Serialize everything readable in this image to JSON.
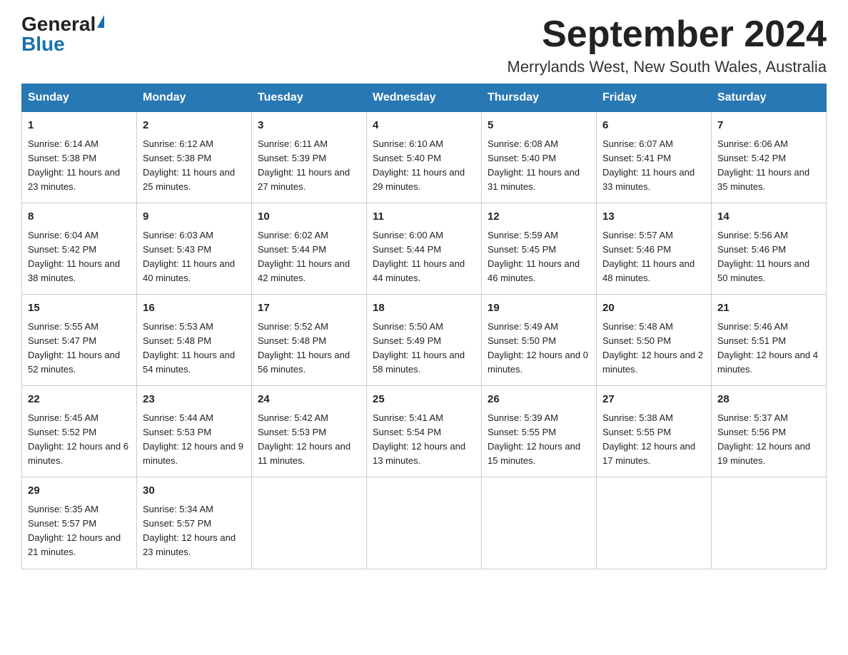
{
  "header": {
    "logo_text_black": "General",
    "logo_text_blue": "Blue",
    "month_title": "September 2024",
    "location": "Merrylands West, New South Wales, Australia"
  },
  "weekdays": [
    "Sunday",
    "Monday",
    "Tuesday",
    "Wednesday",
    "Thursday",
    "Friday",
    "Saturday"
  ],
  "weeks": [
    [
      {
        "day": "1",
        "sunrise": "6:14 AM",
        "sunset": "5:38 PM",
        "daylight": "11 hours and 23 minutes."
      },
      {
        "day": "2",
        "sunrise": "6:12 AM",
        "sunset": "5:38 PM",
        "daylight": "11 hours and 25 minutes."
      },
      {
        "day": "3",
        "sunrise": "6:11 AM",
        "sunset": "5:39 PM",
        "daylight": "11 hours and 27 minutes."
      },
      {
        "day": "4",
        "sunrise": "6:10 AM",
        "sunset": "5:40 PM",
        "daylight": "11 hours and 29 minutes."
      },
      {
        "day": "5",
        "sunrise": "6:08 AM",
        "sunset": "5:40 PM",
        "daylight": "11 hours and 31 minutes."
      },
      {
        "day": "6",
        "sunrise": "6:07 AM",
        "sunset": "5:41 PM",
        "daylight": "11 hours and 33 minutes."
      },
      {
        "day": "7",
        "sunrise": "6:06 AM",
        "sunset": "5:42 PM",
        "daylight": "11 hours and 35 minutes."
      }
    ],
    [
      {
        "day": "8",
        "sunrise": "6:04 AM",
        "sunset": "5:42 PM",
        "daylight": "11 hours and 38 minutes."
      },
      {
        "day": "9",
        "sunrise": "6:03 AM",
        "sunset": "5:43 PM",
        "daylight": "11 hours and 40 minutes."
      },
      {
        "day": "10",
        "sunrise": "6:02 AM",
        "sunset": "5:44 PM",
        "daylight": "11 hours and 42 minutes."
      },
      {
        "day": "11",
        "sunrise": "6:00 AM",
        "sunset": "5:44 PM",
        "daylight": "11 hours and 44 minutes."
      },
      {
        "day": "12",
        "sunrise": "5:59 AM",
        "sunset": "5:45 PM",
        "daylight": "11 hours and 46 minutes."
      },
      {
        "day": "13",
        "sunrise": "5:57 AM",
        "sunset": "5:46 PM",
        "daylight": "11 hours and 48 minutes."
      },
      {
        "day": "14",
        "sunrise": "5:56 AM",
        "sunset": "5:46 PM",
        "daylight": "11 hours and 50 minutes."
      }
    ],
    [
      {
        "day": "15",
        "sunrise": "5:55 AM",
        "sunset": "5:47 PM",
        "daylight": "11 hours and 52 minutes."
      },
      {
        "day": "16",
        "sunrise": "5:53 AM",
        "sunset": "5:48 PM",
        "daylight": "11 hours and 54 minutes."
      },
      {
        "day": "17",
        "sunrise": "5:52 AM",
        "sunset": "5:48 PM",
        "daylight": "11 hours and 56 minutes."
      },
      {
        "day": "18",
        "sunrise": "5:50 AM",
        "sunset": "5:49 PM",
        "daylight": "11 hours and 58 minutes."
      },
      {
        "day": "19",
        "sunrise": "5:49 AM",
        "sunset": "5:50 PM",
        "daylight": "12 hours and 0 minutes."
      },
      {
        "day": "20",
        "sunrise": "5:48 AM",
        "sunset": "5:50 PM",
        "daylight": "12 hours and 2 minutes."
      },
      {
        "day": "21",
        "sunrise": "5:46 AM",
        "sunset": "5:51 PM",
        "daylight": "12 hours and 4 minutes."
      }
    ],
    [
      {
        "day": "22",
        "sunrise": "5:45 AM",
        "sunset": "5:52 PM",
        "daylight": "12 hours and 6 minutes."
      },
      {
        "day": "23",
        "sunrise": "5:44 AM",
        "sunset": "5:53 PM",
        "daylight": "12 hours and 9 minutes."
      },
      {
        "day": "24",
        "sunrise": "5:42 AM",
        "sunset": "5:53 PM",
        "daylight": "12 hours and 11 minutes."
      },
      {
        "day": "25",
        "sunrise": "5:41 AM",
        "sunset": "5:54 PM",
        "daylight": "12 hours and 13 minutes."
      },
      {
        "day": "26",
        "sunrise": "5:39 AM",
        "sunset": "5:55 PM",
        "daylight": "12 hours and 15 minutes."
      },
      {
        "day": "27",
        "sunrise": "5:38 AM",
        "sunset": "5:55 PM",
        "daylight": "12 hours and 17 minutes."
      },
      {
        "day": "28",
        "sunrise": "5:37 AM",
        "sunset": "5:56 PM",
        "daylight": "12 hours and 19 minutes."
      }
    ],
    [
      {
        "day": "29",
        "sunrise": "5:35 AM",
        "sunset": "5:57 PM",
        "daylight": "12 hours and 21 minutes."
      },
      {
        "day": "30",
        "sunrise": "5:34 AM",
        "sunset": "5:57 PM",
        "daylight": "12 hours and 23 minutes."
      },
      null,
      null,
      null,
      null,
      null
    ]
  ]
}
